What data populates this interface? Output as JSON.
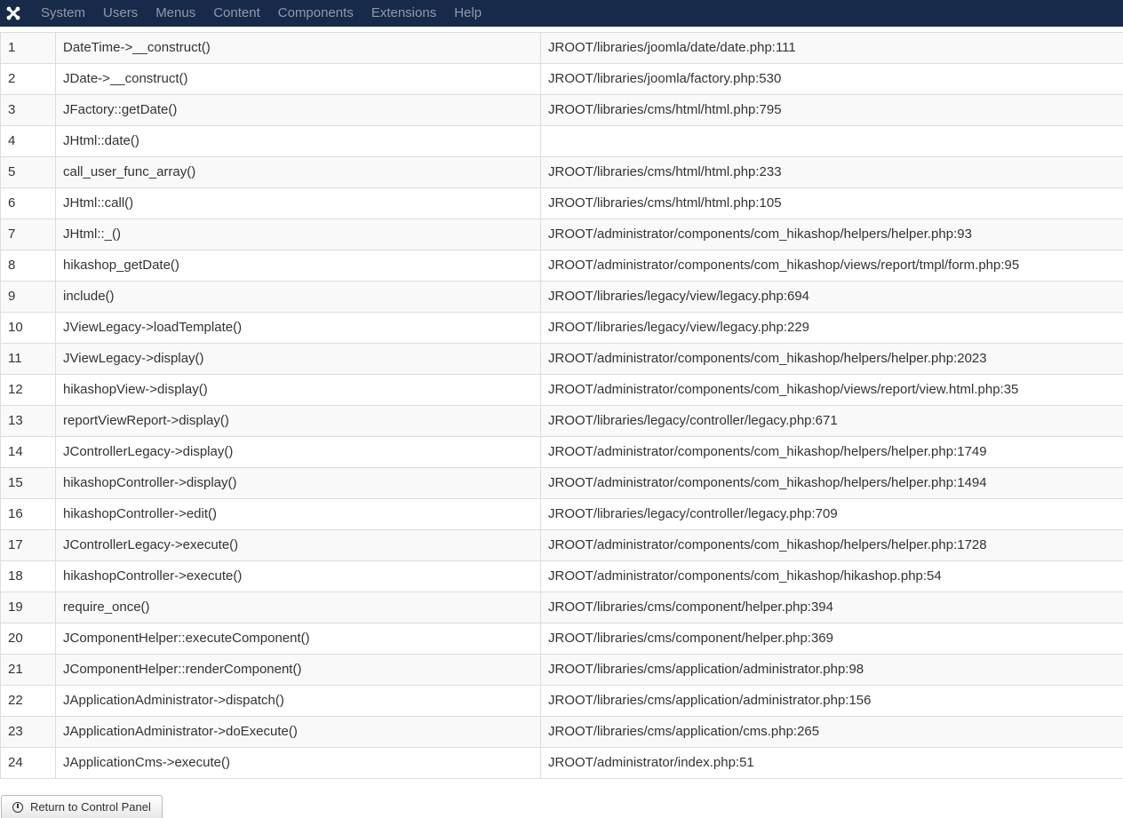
{
  "navbar": {
    "logo_icon": "joomla-logo-icon",
    "menu": [
      "System",
      "Users",
      "Menus",
      "Content",
      "Components",
      "Extensions",
      "Help"
    ]
  },
  "callstack": {
    "rows": [
      {
        "num": "1",
        "function": "DateTime->__construct()",
        "location": "JROOT/libraries/joomla/date/date.php:111"
      },
      {
        "num": "2",
        "function": "JDate->__construct()",
        "location": "JROOT/libraries/joomla/factory.php:530"
      },
      {
        "num": "3",
        "function": "JFactory::getDate()",
        "location": "JROOT/libraries/cms/html/html.php:795"
      },
      {
        "num": "4",
        "function": "JHtml::date()",
        "location": ""
      },
      {
        "num": "5",
        "function": "call_user_func_array()",
        "location": "JROOT/libraries/cms/html/html.php:233"
      },
      {
        "num": "6",
        "function": "JHtml::call()",
        "location": "JROOT/libraries/cms/html/html.php:105"
      },
      {
        "num": "7",
        "function": "JHtml::_()",
        "location": "JROOT/administrator/components/com_hikashop/helpers/helper.php:93"
      },
      {
        "num": "8",
        "function": "hikashop_getDate()",
        "location": "JROOT/administrator/components/com_hikashop/views/report/tmpl/form.php:95"
      },
      {
        "num": "9",
        "function": "include()",
        "location": "JROOT/libraries/legacy/view/legacy.php:694"
      },
      {
        "num": "10",
        "function": "JViewLegacy->loadTemplate()",
        "location": "JROOT/libraries/legacy/view/legacy.php:229"
      },
      {
        "num": "11",
        "function": "JViewLegacy->display()",
        "location": "JROOT/administrator/components/com_hikashop/helpers/helper.php:2023"
      },
      {
        "num": "12",
        "function": "hikashopView->display()",
        "location": "JROOT/administrator/components/com_hikashop/views/report/view.html.php:35"
      },
      {
        "num": "13",
        "function": "reportViewReport->display()",
        "location": "JROOT/libraries/legacy/controller/legacy.php:671"
      },
      {
        "num": "14",
        "function": "JControllerLegacy->display()",
        "location": "JROOT/administrator/components/com_hikashop/helpers/helper.php:1749"
      },
      {
        "num": "15",
        "function": "hikashopController->display()",
        "location": "JROOT/administrator/components/com_hikashop/helpers/helper.php:1494"
      },
      {
        "num": "16",
        "function": "hikashopController->edit()",
        "location": "JROOT/libraries/legacy/controller/legacy.php:709"
      },
      {
        "num": "17",
        "function": "JControllerLegacy->execute()",
        "location": "JROOT/administrator/components/com_hikashop/helpers/helper.php:1728"
      },
      {
        "num": "18",
        "function": "hikashopController->execute()",
        "location": "JROOT/administrator/components/com_hikashop/hikashop.php:54"
      },
      {
        "num": "19",
        "function": "require_once()",
        "location": "JROOT/libraries/cms/component/helper.php:394"
      },
      {
        "num": "20",
        "function": "JComponentHelper::executeComponent()",
        "location": "JROOT/libraries/cms/component/helper.php:369"
      },
      {
        "num": "21",
        "function": "JComponentHelper::renderComponent()",
        "location": "JROOT/libraries/cms/application/administrator.php:98"
      },
      {
        "num": "22",
        "function": "JApplicationAdministrator->dispatch()",
        "location": "JROOT/libraries/cms/application/administrator.php:156"
      },
      {
        "num": "23",
        "function": "JApplicationAdministrator->doExecute()",
        "location": "JROOT/libraries/cms/application/cms.php:265"
      },
      {
        "num": "24",
        "function": "JApplicationCms->execute()",
        "location": "JROOT/administrator/index.php:51"
      }
    ]
  },
  "footer": {
    "return_label": "Return to Control Panel",
    "return_icon": "dashboard-icon"
  }
}
